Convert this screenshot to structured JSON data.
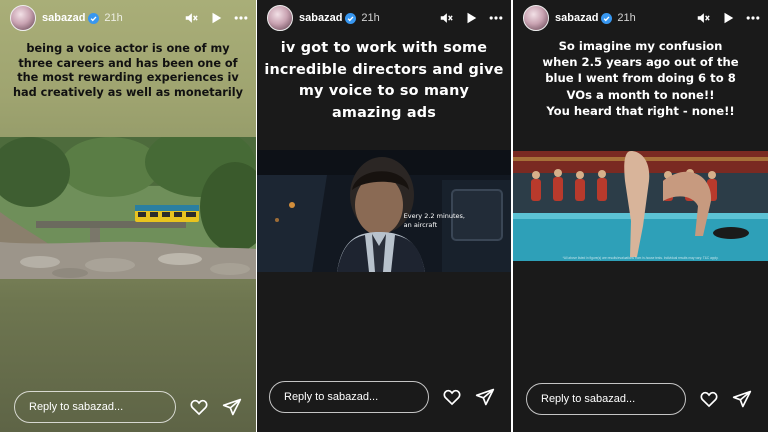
{
  "stories": [
    {
      "username": "sabazad",
      "time": "21h",
      "caption": "being a voice actor is one of my three careers and has been one of the most rewarding experiences iv had creatively as well as monetarily",
      "reply_placeholder": "Reply to sabazad..."
    },
    {
      "username": "sabazad",
      "time": "21h",
      "caption": "iv got to work with some incredible directors and give my voice to so many amazing ads",
      "subtitle_line1": "Every 2.2 minutes,",
      "subtitle_line2": "an aircraft",
      "reply_placeholder": "Reply to sabazad..."
    },
    {
      "username": "sabazad",
      "time": "21h",
      "caption_line1": "So imagine my confusion",
      "caption_line2": "when 2.5 years ago out of the",
      "caption_line3": "blue I went from doing 6 to 8",
      "caption_line4": "VOs a month to none!!",
      "caption_line5": "You heard that right - none!!",
      "fineprint": "*All above listed in figure(s) are results/evaluations from in-house tests. Individual results may vary. T&C apply.",
      "reply_placeholder": "Reply to sabazad..."
    }
  ],
  "icons": {
    "verified": "verified-badge-icon",
    "mute": "speaker-muted-icon",
    "play": "play-icon",
    "more": "more-horizontal-icon",
    "like": "heart-icon",
    "share": "send-icon"
  },
  "colors": {
    "panel_dark": "#1a1a1a",
    "panel_olive": "#9fa470",
    "verified_blue": "#3897f0",
    "text_white": "#ffffff"
  }
}
